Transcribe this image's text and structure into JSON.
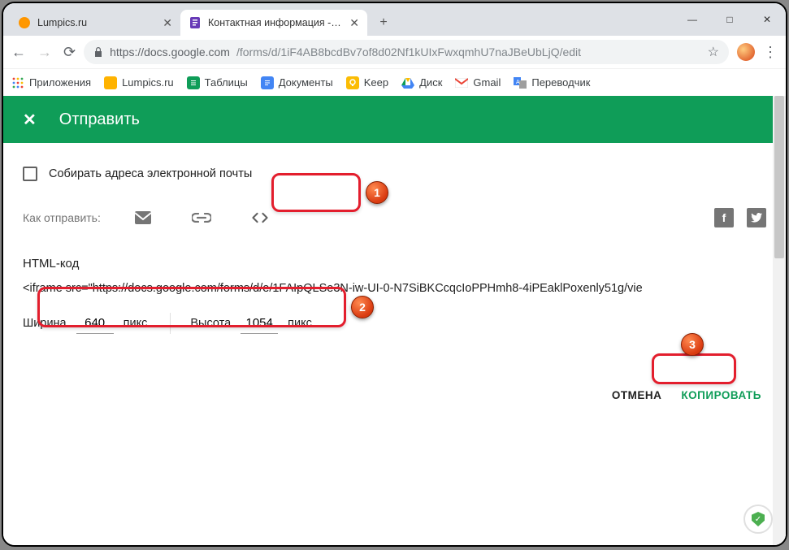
{
  "browser": {
    "tabs": [
      {
        "title": "Lumpics.ru",
        "active": false
      },
      {
        "title": "Контактная информация - Goo…",
        "active": true
      }
    ],
    "url_host": "https://docs.google.com",
    "url_path": "/forms/d/1iF4AB8bcdBv7of8d02Nf1kUIxFwxqmhU7naJBeUbLjQ/edit",
    "bookmarks": [
      {
        "label": "Приложения",
        "icon": "apps"
      },
      {
        "label": "Lumpics.ru",
        "icon": "lumpics"
      },
      {
        "label": "Таблицы",
        "icon": "sheets"
      },
      {
        "label": "Документы",
        "icon": "docs"
      },
      {
        "label": "Keep",
        "icon": "keep"
      },
      {
        "label": "Диск",
        "icon": "drive"
      },
      {
        "label": "Gmail",
        "icon": "gmail"
      },
      {
        "label": "Переводчик",
        "icon": "translate"
      }
    ]
  },
  "dialog": {
    "title": "Отправить",
    "collect_label": "Собирать адреса электронной почты",
    "how_label": "Как отправить:",
    "section_title": "HTML-код",
    "iframe_code": "<iframe src=\"https://docs.google.com/forms/d/e/1FAIpQLSe3N-iw-UI-0-N7SiBKCcqcIoPPHmh8-4iPEaklPoxenly51g/vie",
    "width_label": "Ширина",
    "width_value": "640",
    "height_label": "Высота",
    "height_value": "1054",
    "unit_suffix": "пикс.",
    "cancel_label": "ОТМЕНА",
    "copy_label": "КОПИРОВАТЬ"
  },
  "callouts": {
    "one": "1",
    "two": "2",
    "three": "3"
  }
}
